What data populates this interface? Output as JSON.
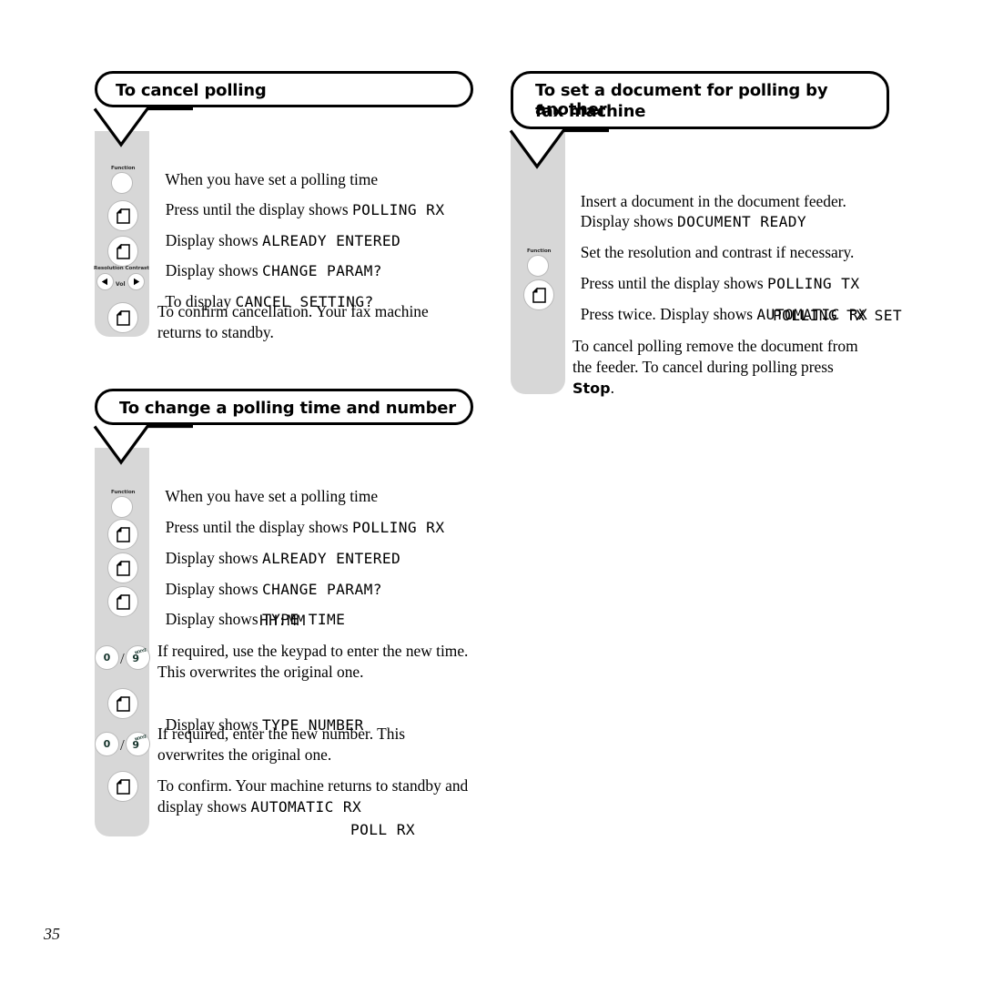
{
  "page": {
    "number": "35"
  },
  "sections": [
    {
      "id": "cancel-polling",
      "title": "To cancel polling",
      "title_lines": [
        "To cancel polling"
      ],
      "steps": [
        {
          "icon": "none",
          "text": "When you have set a polling time",
          "lcd": ""
        },
        {
          "icon": "function-button",
          "text": "Press until the display shows ",
          "lcd": "POLLING RX"
        },
        {
          "icon": "page-button",
          "text": "Display shows ",
          "lcd": "ALREADY ENTERED"
        },
        {
          "icon": "page-button",
          "text": "Display shows ",
          "lcd": "CHANGE PARAM?"
        },
        {
          "icon": "resolution-vol-contrast",
          "text": "To display ",
          "lcd": "CANCEL SETTING?"
        },
        {
          "icon": "page-button",
          "text": "To confirm cancellation. Your fax machine returns to standby.",
          "lcd": ""
        }
      ]
    },
    {
      "id": "change-polling-time-and-number",
      "title": "To change a polling time and number",
      "title_lines": [
        "To change a polling time and number"
      ],
      "steps": [
        {
          "icon": "none",
          "text": "When you have set a polling time",
          "lcd": ""
        },
        {
          "icon": "function-button",
          "text": "Press until the display shows ",
          "lcd": "POLLING RX"
        },
        {
          "icon": "page-button",
          "text": "Display shows ",
          "lcd": "ALREADY ENTERED"
        },
        {
          "icon": "page-button",
          "text": "Display shows ",
          "lcd": "CHANGE PARAM?"
        },
        {
          "icon": "page-button",
          "text": "Display shows ",
          "lcd": "TYPE TIME",
          "lcd2": "HH:MM"
        },
        {
          "icon": "keypad-0-9",
          "text": "If required, use the keypad to enter the new time. This overwrites the original one.",
          "lcd": ""
        },
        {
          "icon": "page-button",
          "text": "Display shows ",
          "lcd": "TYPE NUMBER"
        },
        {
          "icon": "keypad-0-9",
          "text": "If required, enter the new number. This overwrites the original one.",
          "lcd": ""
        },
        {
          "icon": "page-button",
          "text": "To confirm. Your machine returns to standby and display shows ",
          "lcd": "AUTOMATIC RX",
          "lcd2": "POLL RX"
        }
      ]
    },
    {
      "id": "set-document-for-polling",
      "title": "To set a document for polling by another fax machine",
      "title_lines": [
        "To set a document for polling by another",
        "fax machine"
      ],
      "steps": [
        {
          "icon": "none",
          "text": "Insert a document in the document feeder.",
          "text2": "Display shows ",
          "lcd": "DOCUMENT READY"
        },
        {
          "icon": "none",
          "text": "Set the resolution and contrast if necessary.",
          "lcd": ""
        },
        {
          "icon": "function-button",
          "text": "Press until the display shows ",
          "lcd": "POLLING TX"
        },
        {
          "icon": "page-button",
          "text": "Press twice. Display shows ",
          "lcd": "AUTOMATIC RX",
          "lcd2": "POLLING TX SET"
        },
        {
          "icon": "none",
          "text": "To cancel polling remove the document from the feeder. To cancel during polling press ",
          "bold": "Stop",
          "text_tail": ".",
          "lcd": ""
        }
      ]
    }
  ],
  "icons": {
    "function_label": "Function",
    "resolution_label": "Resolution",
    "contrast_label": "Contrast",
    "vol_label": "Vol",
    "key_zero": "0",
    "key_nine": "9",
    "key_nine_sup": "WXYZ",
    "slash": "/"
  },
  "colors": {
    "strip_grey": "#d7d7d7",
    "outline_black": "#000000",
    "page_white": "#ffffff"
  }
}
